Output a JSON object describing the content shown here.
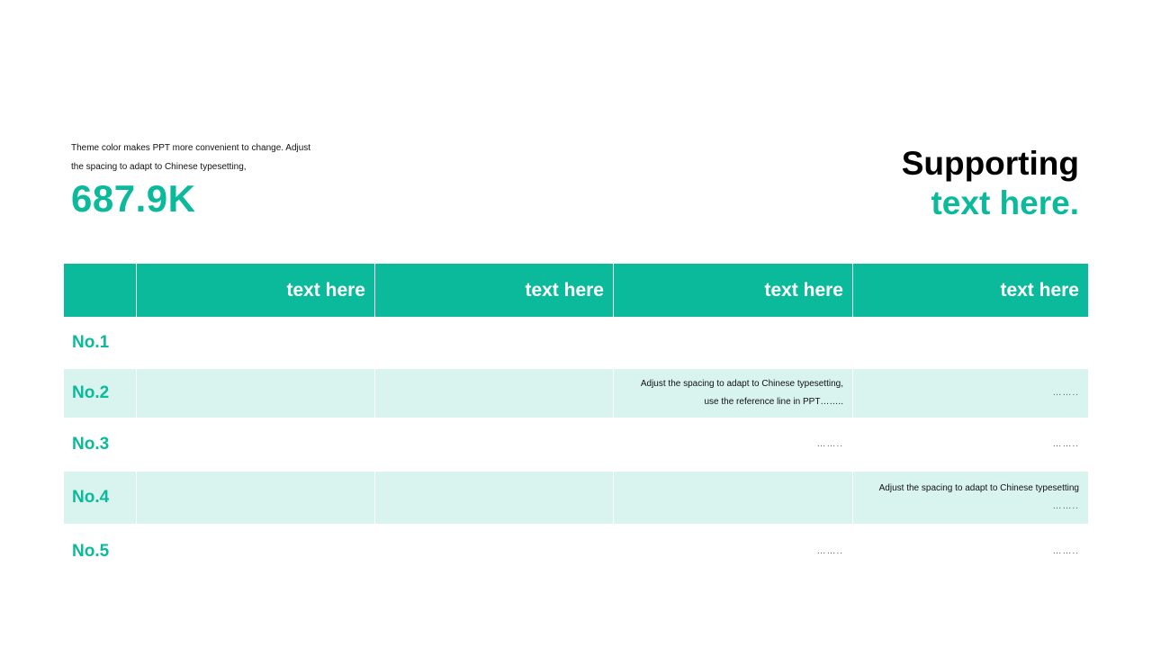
{
  "intro": {
    "line1": "Theme color makes PPT more convenient to change. Adjust",
    "line2": "the spacing to adapt to Chinese typesetting,"
  },
  "stat": {
    "value": "687.9K"
  },
  "supporting": {
    "line1": "Supporting",
    "line2": "text here."
  },
  "table": {
    "headers": [
      "",
      "text here",
      "text here",
      "text here",
      "text here"
    ],
    "rows": [
      {
        "label": "No.1",
        "cells": [
          "",
          "",
          "",
          ""
        ]
      },
      {
        "label": "No.2",
        "cells": [
          "",
          "",
          "Adjust the spacing to adapt to Chinese typesetting,|use the reference line in PPT……..",
          "…….."
        ]
      },
      {
        "label": "No.3",
        "cells": [
          "",
          "",
          "……..",
          "…….."
        ]
      },
      {
        "label": "No.4",
        "cells": [
          "",
          "",
          "",
          "Adjust the spacing to adapt to Chinese typesetting|…….."
        ]
      },
      {
        "label": "No.5",
        "cells": [
          "",
          "",
          "……..",
          "…….."
        ]
      }
    ]
  },
  "colors": {
    "accent": "#0bba9a",
    "row_alt": "#d9f4ef",
    "text": "#111111"
  }
}
